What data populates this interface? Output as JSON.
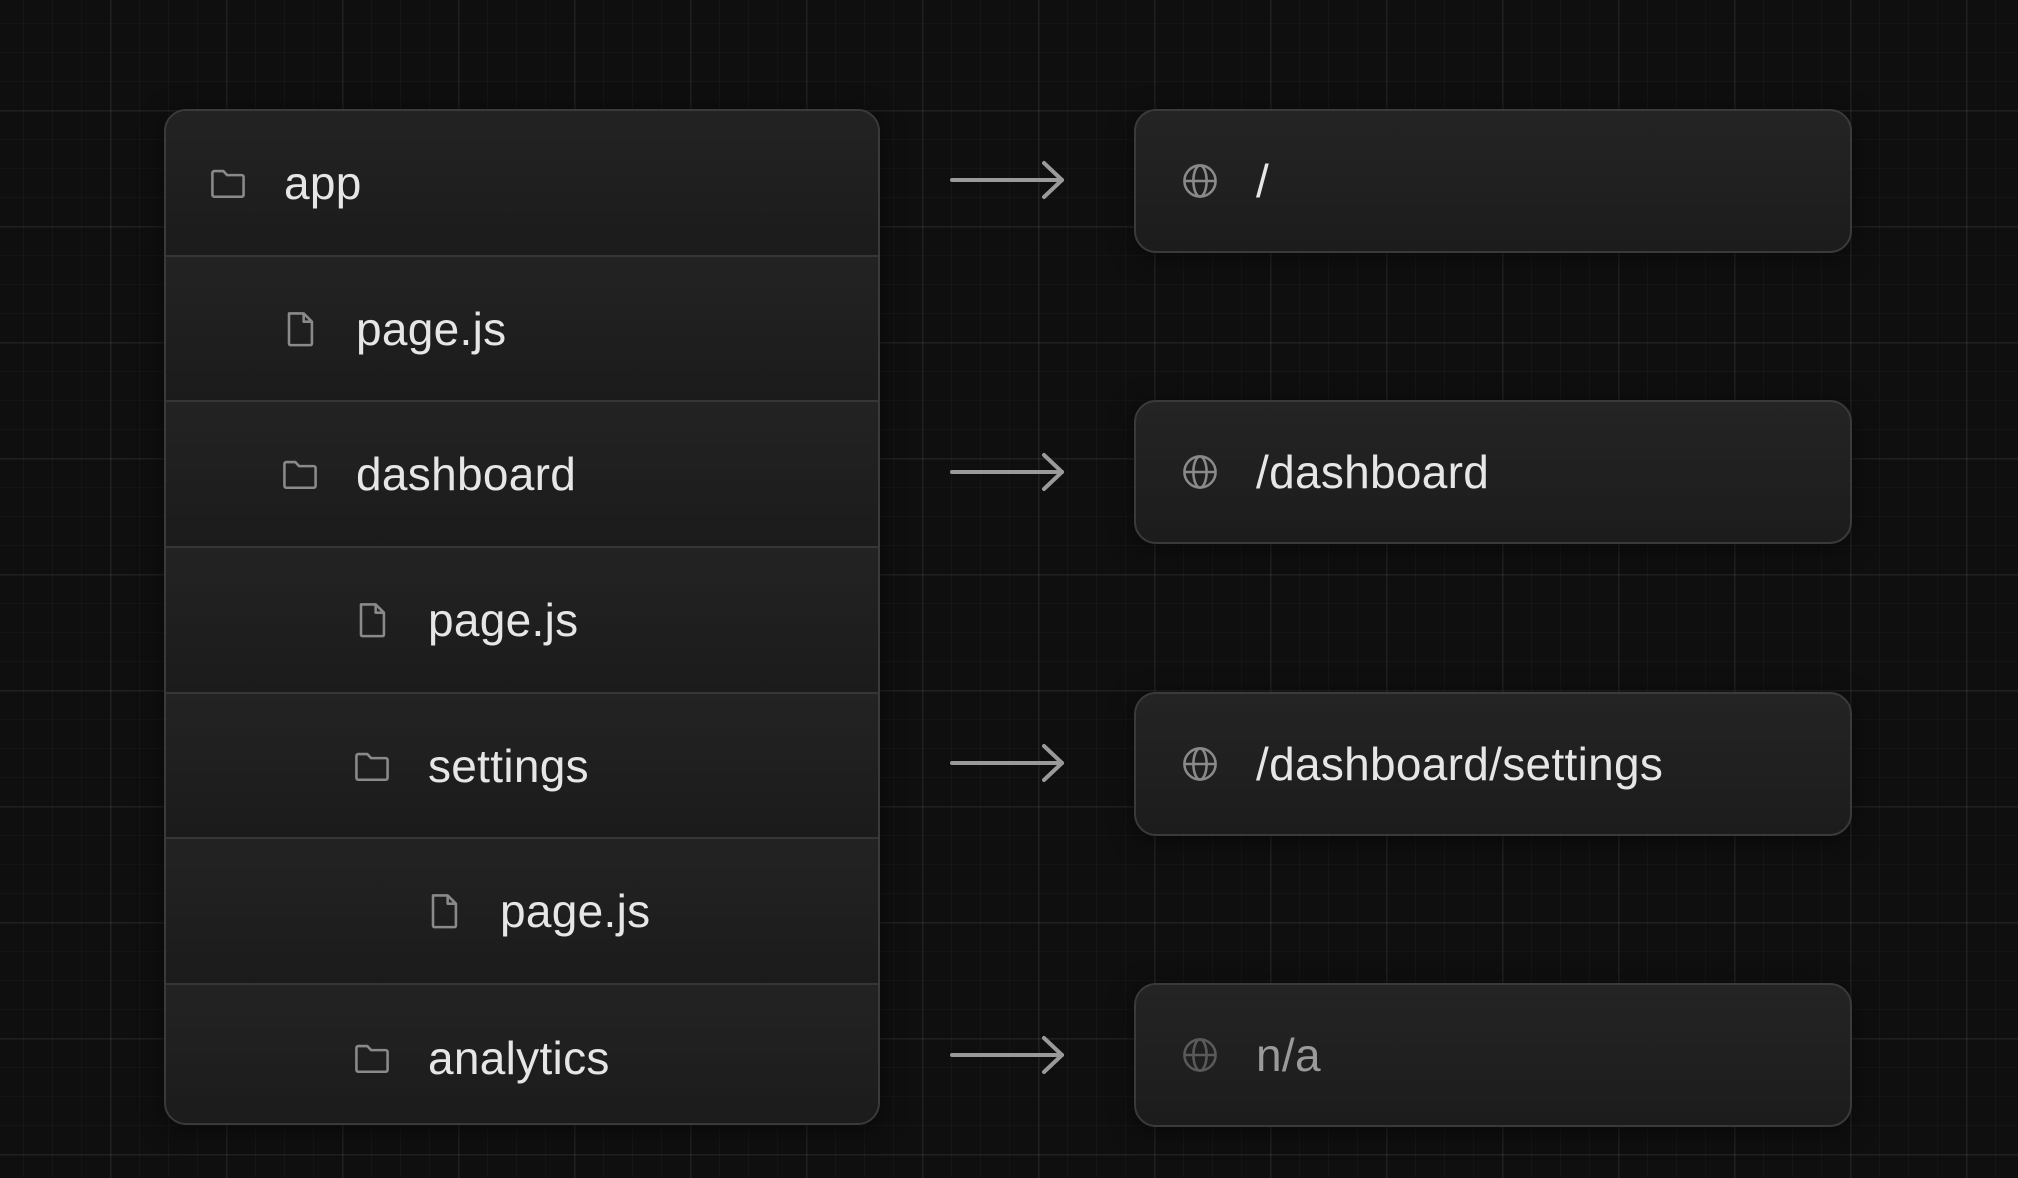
{
  "tree": {
    "items": [
      {
        "label": "app",
        "type": "folder",
        "depth": 0
      },
      {
        "label": "page.js",
        "type": "file",
        "depth": 1
      },
      {
        "label": "dashboard",
        "type": "folder",
        "depth": 1
      },
      {
        "label": "page.js",
        "type": "file",
        "depth": 2
      },
      {
        "label": "settings",
        "type": "folder",
        "depth": 2
      },
      {
        "label": "page.js",
        "type": "file",
        "depth": 3
      },
      {
        "label": "analytics",
        "type": "folder",
        "depth": 2
      }
    ]
  },
  "routes": [
    {
      "label": "/",
      "from_item": 0,
      "muted": false
    },
    {
      "label": "/dashboard",
      "from_item": 2,
      "muted": false
    },
    {
      "label": "/dashboard/settings",
      "from_item": 4,
      "muted": false
    },
    {
      "label": "n/a",
      "from_item": 6,
      "muted": true
    }
  ],
  "icons": {
    "folder": "folder-icon",
    "file": "file-icon",
    "route": "globe-icon",
    "connector": "arrow-right-icon"
  },
  "colors": {
    "background": "#0f0f0f",
    "panel": "#1d1d1d",
    "border": "#3a3a3a",
    "text": "#e6e6e6",
    "muted_text": "#9a9a9a",
    "icon": "#8a8a8a",
    "arrow": "#9a9a9a"
  }
}
